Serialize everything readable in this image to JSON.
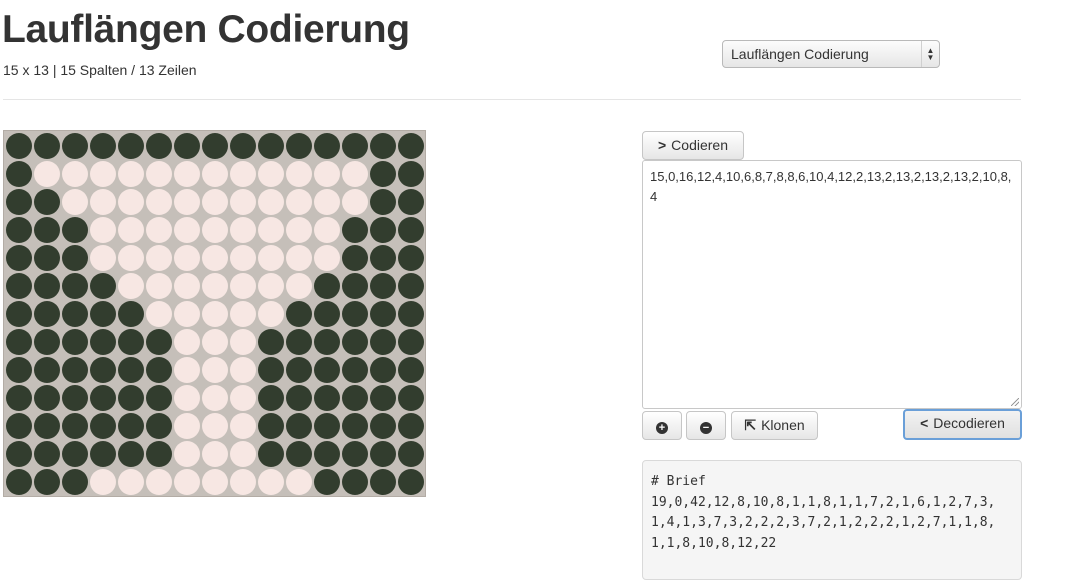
{
  "header": {
    "title": "Lauflängen Codierung",
    "subtitle": "15 x 13 | 15 Spalten / 13 Zeilen"
  },
  "select": {
    "value": "Lauflängen Codierung"
  },
  "grid": {
    "columns": 15,
    "rows": 13,
    "colors": {
      "on": "#323d2e",
      "off": "#f7e7e3",
      "background": "#c5bfb9"
    },
    "pixels": [
      "111111111111111",
      "100000000000011",
      "110000000000011",
      "111000000000111",
      "111000000000111",
      "111100000001111",
      "111110000011111",
      "111111000111111",
      "111111000111111",
      "111111000111111",
      "111111000111111",
      "111111000111111",
      "111000000001111"
    ]
  },
  "buttons": {
    "encode": "Codieren",
    "clone": "Klonen",
    "decode": "Decodieren",
    "zoom_in_icon": "plus-circle-icon",
    "zoom_out_icon": "minus-circle-icon"
  },
  "encoded_text": "15,0,16,12,4,10,6,8,7,8,8,6,10,4,12,2,13,2,13,2,13,2,13,2,10,8,4",
  "example": {
    "text": "# Brief\n19,0,42,12,8,10,8,1,1,8,1,1,7,2,1,6,1,2,7,3,\n1,4,1,3,7,3,2,2,2,3,7,2,1,2,2,2,1,2,7,1,1,8,\n1,1,8,10,8,12,22"
  }
}
